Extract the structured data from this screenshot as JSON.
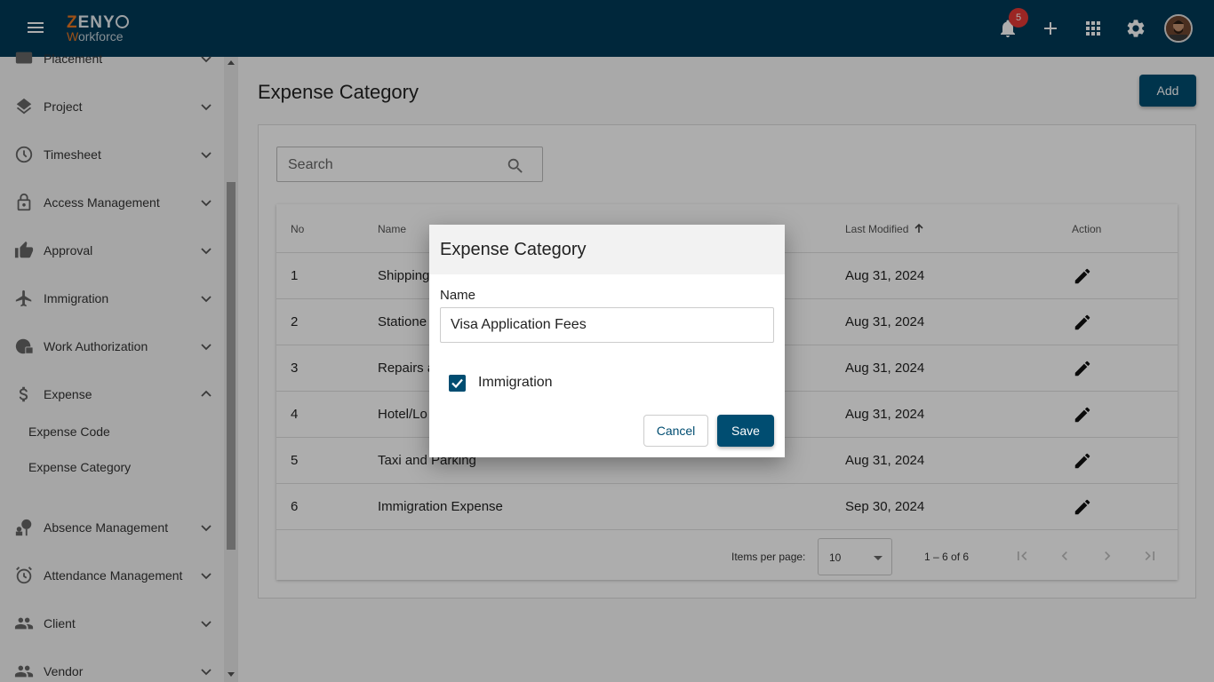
{
  "header": {
    "logo_top": "ZENY",
    "logo_bottom": "Workforce",
    "notification_count": "5"
  },
  "sidebar": {
    "items": [
      {
        "label": "Placement",
        "icon": "placement-icon"
      },
      {
        "label": "Project",
        "icon": "layers-icon"
      },
      {
        "label": "Timesheet",
        "icon": "clock-icon"
      },
      {
        "label": "Access Management",
        "icon": "lock-icon"
      },
      {
        "label": "Approval",
        "icon": "thumbs-up-icon"
      },
      {
        "label": "Immigration",
        "icon": "airplane-icon"
      },
      {
        "label": "Work Authorization",
        "icon": "globe-lock-icon"
      },
      {
        "label": "Expense",
        "icon": "dollar-icon"
      },
      {
        "label": "Absence Management",
        "icon": "person-absence-icon"
      },
      {
        "label": "Attendance Management",
        "icon": "alarm-icon"
      },
      {
        "label": "Client",
        "icon": "people-icon"
      },
      {
        "label": "Vendor",
        "icon": "people-icon"
      }
    ],
    "expense_sub": [
      "Expense Code",
      "Expense Category"
    ]
  },
  "main": {
    "title": "Expense Category",
    "add_label": "Add",
    "search_placeholder": "Search",
    "columns": {
      "no": "No",
      "name": "Name",
      "last_modified": "Last Modified",
      "action": "Action"
    },
    "rows": [
      {
        "no": "1",
        "name": "Shipping",
        "date": "Aug 31, 2024"
      },
      {
        "no": "2",
        "name": "Statione",
        "date": "Aug 31, 2024"
      },
      {
        "no": "3",
        "name": "Repairs a",
        "date": "Aug 31, 2024"
      },
      {
        "no": "4",
        "name": "Hotel/Lo",
        "date": "Aug 31, 2024"
      },
      {
        "no": "5",
        "name": "Taxi and Parking",
        "date": "Aug 31, 2024"
      },
      {
        "no": "6",
        "name": "Immigration Expense",
        "date": "Sep 30, 2024"
      }
    ],
    "items_per_page_label": "Items per page:",
    "items_per_page": "10",
    "range": "1 – 6 of 6"
  },
  "dialog": {
    "title": "Expense Category",
    "name_label": "Name",
    "name_value": "Visa Application Fees",
    "checkbox_label": "Immigration",
    "checkbox_checked": true,
    "cancel_label": "Cancel",
    "save_label": "Save"
  },
  "colors": {
    "topbar": "#003a57",
    "primary": "#004d71",
    "badge": "#e53935",
    "logo_accent": "#e87722"
  }
}
